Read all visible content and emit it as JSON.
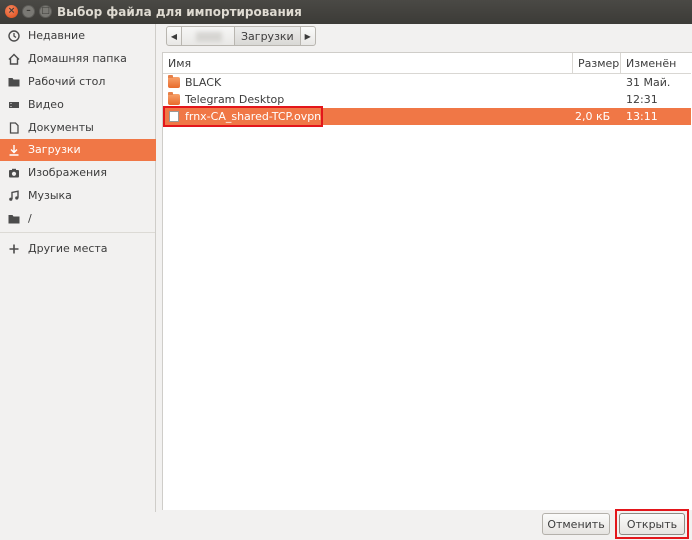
{
  "window": {
    "title": "Выбор файла для импортирования"
  },
  "sidebar": {
    "items": [
      {
        "label": "Недавние",
        "icon": "recent-icon"
      },
      {
        "label": "Домашняя папка",
        "icon": "home-icon"
      },
      {
        "label": "Рабочий стол",
        "icon": "desktop-folder-icon"
      },
      {
        "label": "Видео",
        "icon": "video-icon"
      },
      {
        "label": "Документы",
        "icon": "document-icon"
      },
      {
        "label": "Загрузки",
        "icon": "download-icon",
        "selected": true
      },
      {
        "label": "Изображения",
        "icon": "camera-icon"
      },
      {
        "label": "Музыка",
        "icon": "music-icon"
      },
      {
        "label": "/",
        "icon": "folder-icon"
      }
    ],
    "other": {
      "label": "Другие места",
      "icon": "plus-icon"
    }
  },
  "pathbar": {
    "current": "Загрузки"
  },
  "filelist": {
    "columns": {
      "name": "Имя",
      "size": "Размер",
      "modified": "Изменён"
    },
    "rows": [
      {
        "name": "BLACK",
        "type": "folder",
        "size": "",
        "modified": "31 Май."
      },
      {
        "name": "Telegram Desktop",
        "type": "folder",
        "size": "",
        "modified": "12:31"
      },
      {
        "name": "frnx-CA_shared-TCP.ovpn",
        "type": "file",
        "size": "2,0 кБ",
        "modified": "13:11",
        "selected": true
      }
    ]
  },
  "buttons": {
    "cancel": "Отменить",
    "open": "Открыть"
  },
  "colors": {
    "accent": "#f07746",
    "highlight_box": "#e3161b",
    "titlebar": "#3c3b37"
  }
}
